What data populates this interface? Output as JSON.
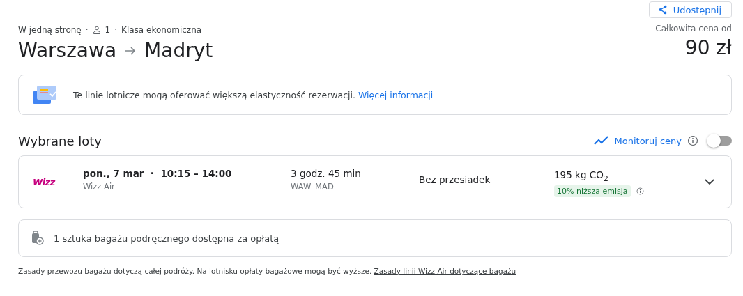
{
  "share_button": {
    "label": "Udostępnij"
  },
  "trip": {
    "type": "W jedną stronę",
    "separator": "·",
    "passengers": "1",
    "cabin": "Klasa ekonomiczna",
    "origin": "Warszawa",
    "destination": "Madryt"
  },
  "price": {
    "label": "Całkowita cena od",
    "value": "90 zł"
  },
  "info_banner": {
    "text": "Te linie lotnicze mogą oferować większą elastyczność rezerwacji.",
    "link": "Więcej informacji"
  },
  "section": {
    "title": "Wybrane loty",
    "track_prices": {
      "label": "Monitoruj ceny",
      "on": false
    }
  },
  "flights": [
    {
      "logo_text": "Wizz",
      "date": "pon., 7 mar",
      "separator": "·",
      "times": "10:15 – 14:00",
      "airline": "Wizz Air",
      "duration": "3 godz. 45 min",
      "route": "WAW–MAD",
      "stops": "Bez przesiadek",
      "emissions": "195 kg CO$_{2}$",
      "emissions_badge": "10% niższa emisja",
      "expanded": false
    }
  ],
  "baggage": {
    "text": "1 sztuka bagażu podręcznego dostępna za opłatą"
  },
  "footer": {
    "text": "Zasady przewozu bagażu dotyczą całej podróży. Na lotnisku opłaty bagażowe mogą być wyższe.",
    "link": "Zasady linii Wizz Air dotyczące bagażu"
  }
}
